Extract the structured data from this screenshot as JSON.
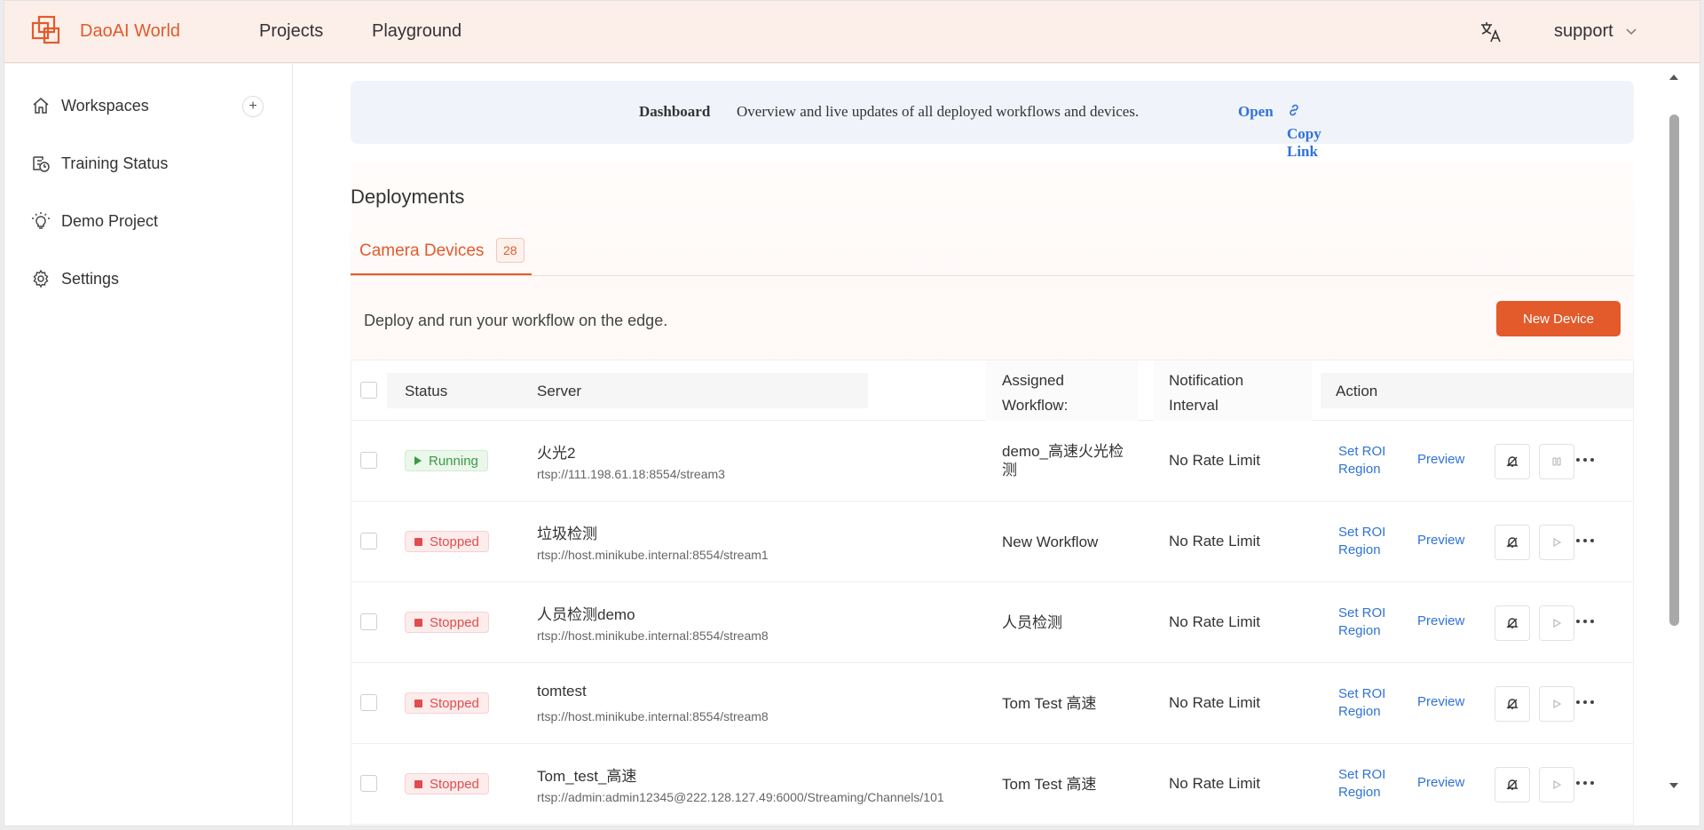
{
  "header": {
    "brand": "DaoAI World",
    "nav": [
      "Projects",
      "Playground"
    ],
    "user": "support",
    "accent_color": "#e35a2b"
  },
  "sidebar": {
    "items": [
      {
        "label": "Workspaces",
        "icon": "home-icon"
      },
      {
        "label": "Training Status",
        "icon": "training-icon"
      },
      {
        "label": "Demo Project",
        "icon": "lightbulb-icon"
      },
      {
        "label": "Settings",
        "icon": "gear-icon"
      }
    ],
    "add_symbol": "+"
  },
  "banner": {
    "title": "Dashboard",
    "description": "Overview and live updates of all deployed workflows and devices.",
    "open": "Open",
    "copy_link": "Copy Link"
  },
  "deployments": {
    "title": "Deployments",
    "tab_label": "Camera Devices",
    "tab_count": "28",
    "description": "Deploy and run your workflow on the edge.",
    "new_button": "New Device"
  },
  "table": {
    "headers": {
      "status": "Status",
      "server": "Server",
      "workflow": "Assigned Workflow:",
      "notification": "Notification Interval",
      "action": "Action"
    },
    "action_labels": {
      "roi": "Set ROI Region",
      "preview": "Preview"
    },
    "rows": [
      {
        "status": "Running",
        "name": "火光2",
        "url": "rtsp://111.198.61.18:8554/stream3",
        "workflow": "demo_高速火光检测",
        "rate": "No Rate Limit"
      },
      {
        "status": "Stopped",
        "name": "垃圾检测",
        "url": "rtsp://host.minikube.internal:8554/stream1",
        "workflow": "New Workflow",
        "rate": "No Rate Limit"
      },
      {
        "status": "Stopped",
        "name": "人员检测demo",
        "url": "rtsp://host.minikube.internal:8554/stream8",
        "workflow": "人员检测",
        "rate": "No Rate Limit"
      },
      {
        "status": "Stopped",
        "name": "tomtest",
        "url": "rtsp://host.minikube.internal:8554/stream8",
        "workflow": "Tom Test 高速",
        "rate": "No Rate Limit"
      },
      {
        "status": "Stopped",
        "name": "Tom_test_高速",
        "url": "rtsp://admin:admin12345@222.128.127.49:6000/Streaming/Channels/101",
        "workflow": "Tom Test 高速",
        "rate": "No Rate Limit"
      }
    ]
  }
}
